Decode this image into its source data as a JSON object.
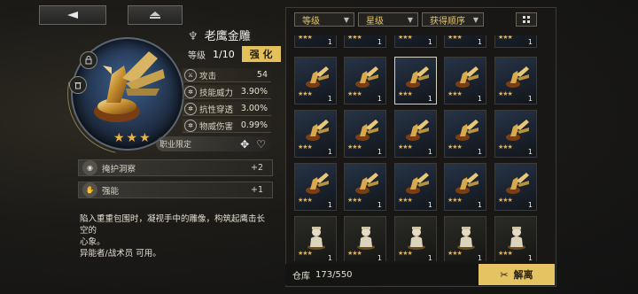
{
  "item": {
    "name": "老鹰金雕",
    "level_label": "等级",
    "level_value": "1/10",
    "enhance_label": "强 化",
    "stars": "★★★"
  },
  "stats": [
    {
      "label": "攻击",
      "value": "54",
      "icon": "sword-icon"
    },
    {
      "label": "技能威力",
      "value": "3.90%",
      "icon": "gear-icon"
    },
    {
      "label": "抗性穿透",
      "value": "3.00%",
      "icon": "gear-icon"
    },
    {
      "label": "物威伤害",
      "value": "0.99%",
      "icon": "gear-icon"
    }
  ],
  "job": {
    "label": "职业限定"
  },
  "skills": [
    {
      "label": "掩护洞察",
      "value": "+2",
      "icon": "eye-icon"
    },
    {
      "label": "强能",
      "value": "+1",
      "icon": "hand-icon"
    }
  ],
  "description": {
    "line1": "陷入重重包围时，凝视手中的雕像，构筑起鹰击长空的",
    "line2": "心象。",
    "line3": "异能者/战术员 可用。"
  },
  "filters": {
    "level": "等级",
    "star": "星级",
    "order": "获得顺序"
  },
  "inventory": {
    "storage_label": "仓库",
    "storage_value": "173/550",
    "dismantle_label": "解离",
    "count": "1",
    "card_stars": "★★★"
  },
  "colors": {
    "accent": "#e5c262",
    "star": "#e9b24a",
    "card_bg": "#1e2838"
  }
}
